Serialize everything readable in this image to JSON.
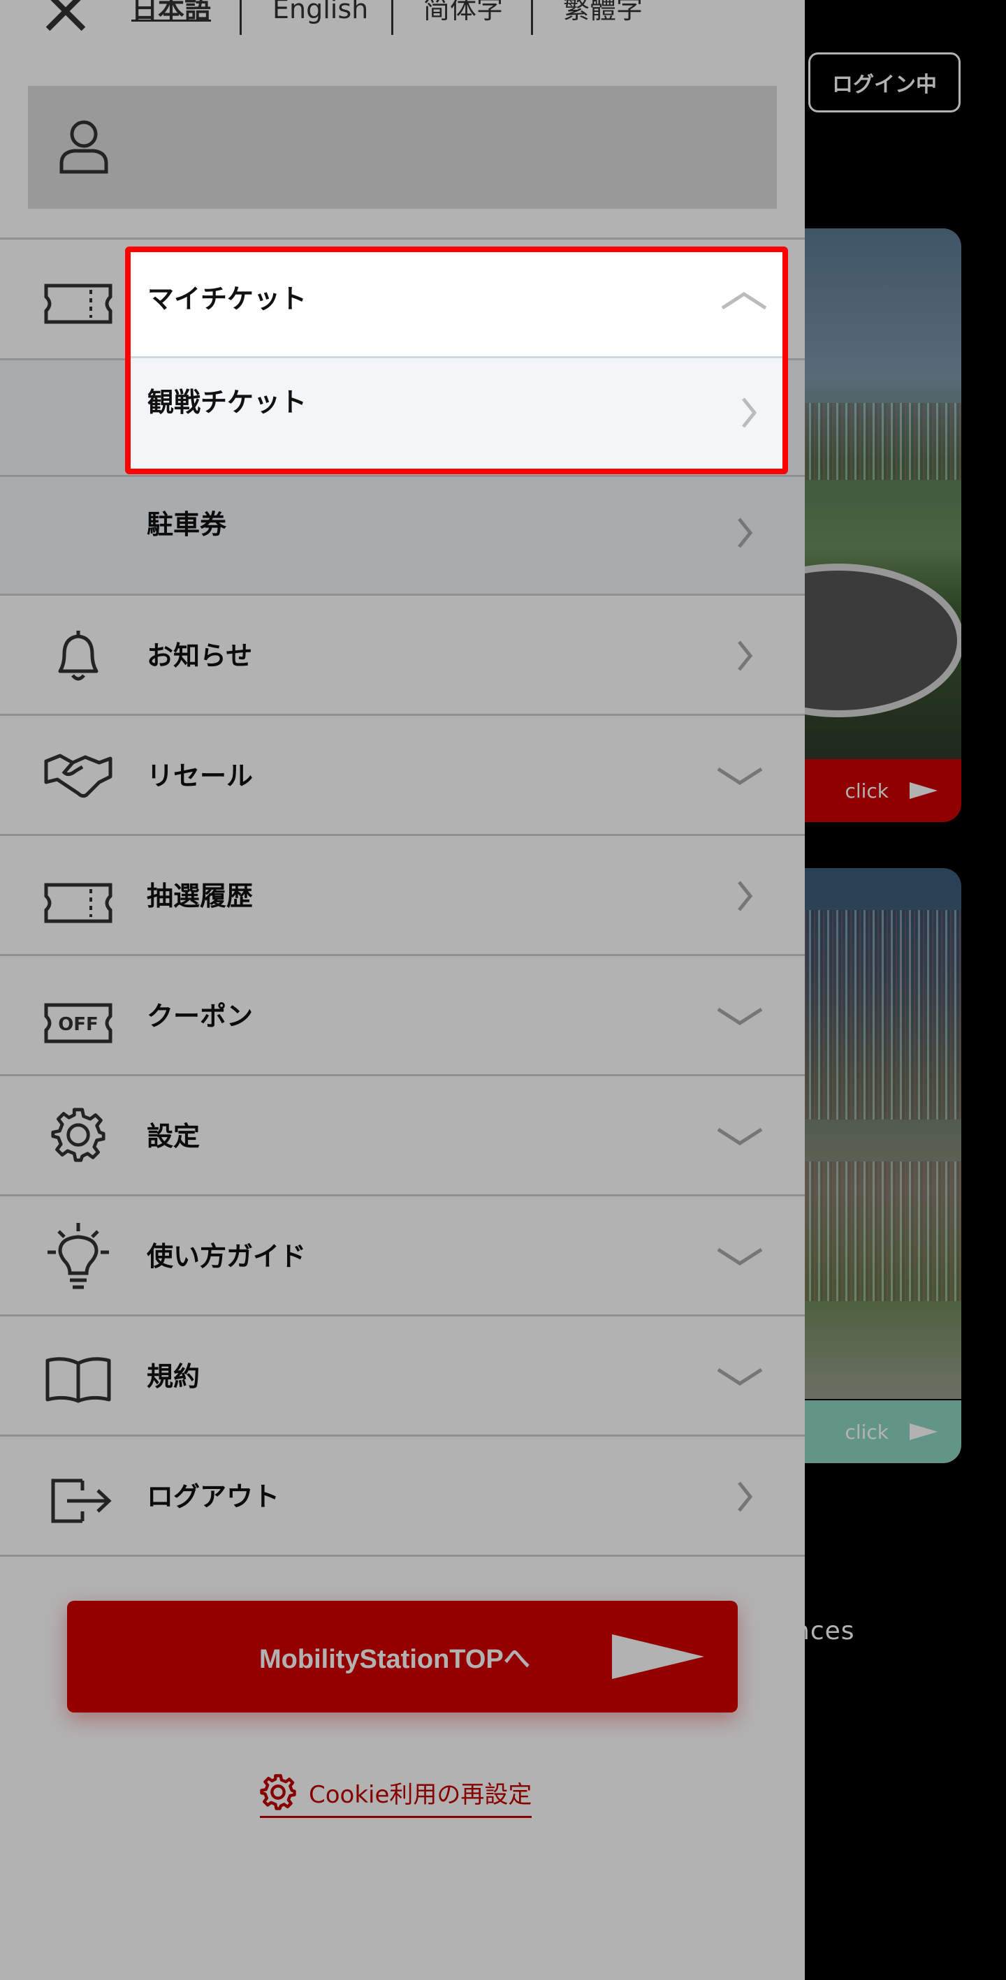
{
  "header": {
    "languages": [
      "日本語",
      "English",
      "简体字",
      "繁體字"
    ],
    "active_language": "日本語",
    "login_status": "ログイン中"
  },
  "menu": {
    "items": [
      {
        "label": "マイチケット",
        "icon": "ticket-icon",
        "control": "chevron-up"
      },
      {
        "label": "観戦チケット",
        "icon": null,
        "control": "chevron-right"
      },
      {
        "label": "駐車券",
        "icon": null,
        "control": "chevron-right"
      },
      {
        "label": "お知らせ",
        "icon": "bell-icon",
        "control": "chevron-right"
      },
      {
        "label": "リセール",
        "icon": "handshake-icon",
        "control": "chevron-down"
      },
      {
        "label": "抽選履歴",
        "icon": "ticket-icon",
        "control": "chevron-right"
      },
      {
        "label": "クーポン",
        "icon": "coupon-off-icon",
        "control": "chevron-down"
      },
      {
        "label": "設定",
        "icon": "gear-icon",
        "control": "chevron-down"
      },
      {
        "label": "使い方ガイド",
        "icon": "lightbulb-icon",
        "control": "chevron-down"
      },
      {
        "label": "規約",
        "icon": "book-icon",
        "control": "chevron-down"
      },
      {
        "label": "ログアウト",
        "icon": "logout-icon",
        "control": "chevron-right"
      }
    ],
    "coupon_icon_text": "OFF",
    "top_button": "MobilityStationTOPへ",
    "cookie_link": "Cookie利用の再設定"
  },
  "background": {
    "card_buttons": [
      "click",
      "click"
    ],
    "partial_text": "nces"
  },
  "colors": {
    "brand_red": "#d40000",
    "highlight": "#ff0000",
    "teal": "#8fd6c2"
  }
}
